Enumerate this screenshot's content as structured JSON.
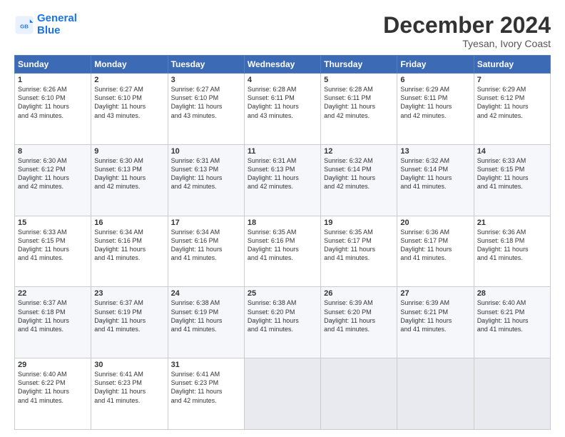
{
  "header": {
    "logo_line1": "General",
    "logo_line2": "Blue",
    "month": "December 2024",
    "location": "Tyesan, Ivory Coast"
  },
  "days_of_week": [
    "Sunday",
    "Monday",
    "Tuesday",
    "Wednesday",
    "Thursday",
    "Friday",
    "Saturday"
  ],
  "weeks": [
    [
      {
        "day": 1,
        "lines": [
          "Sunrise: 6:26 AM",
          "Sunset: 6:10 PM",
          "Daylight: 11 hours",
          "and 43 minutes."
        ]
      },
      {
        "day": 2,
        "lines": [
          "Sunrise: 6:27 AM",
          "Sunset: 6:10 PM",
          "Daylight: 11 hours",
          "and 43 minutes."
        ]
      },
      {
        "day": 3,
        "lines": [
          "Sunrise: 6:27 AM",
          "Sunset: 6:10 PM",
          "Daylight: 11 hours",
          "and 43 minutes."
        ]
      },
      {
        "day": 4,
        "lines": [
          "Sunrise: 6:28 AM",
          "Sunset: 6:11 PM",
          "Daylight: 11 hours",
          "and 43 minutes."
        ]
      },
      {
        "day": 5,
        "lines": [
          "Sunrise: 6:28 AM",
          "Sunset: 6:11 PM",
          "Daylight: 11 hours",
          "and 42 minutes."
        ]
      },
      {
        "day": 6,
        "lines": [
          "Sunrise: 6:29 AM",
          "Sunset: 6:11 PM",
          "Daylight: 11 hours",
          "and 42 minutes."
        ]
      },
      {
        "day": 7,
        "lines": [
          "Sunrise: 6:29 AM",
          "Sunset: 6:12 PM",
          "Daylight: 11 hours",
          "and 42 minutes."
        ]
      }
    ],
    [
      {
        "day": 8,
        "lines": [
          "Sunrise: 6:30 AM",
          "Sunset: 6:12 PM",
          "Daylight: 11 hours",
          "and 42 minutes."
        ]
      },
      {
        "day": 9,
        "lines": [
          "Sunrise: 6:30 AM",
          "Sunset: 6:13 PM",
          "Daylight: 11 hours",
          "and 42 minutes."
        ]
      },
      {
        "day": 10,
        "lines": [
          "Sunrise: 6:31 AM",
          "Sunset: 6:13 PM",
          "Daylight: 11 hours",
          "and 42 minutes."
        ]
      },
      {
        "day": 11,
        "lines": [
          "Sunrise: 6:31 AM",
          "Sunset: 6:13 PM",
          "Daylight: 11 hours",
          "and 42 minutes."
        ]
      },
      {
        "day": 12,
        "lines": [
          "Sunrise: 6:32 AM",
          "Sunset: 6:14 PM",
          "Daylight: 11 hours",
          "and 42 minutes."
        ]
      },
      {
        "day": 13,
        "lines": [
          "Sunrise: 6:32 AM",
          "Sunset: 6:14 PM",
          "Daylight: 11 hours",
          "and 41 minutes."
        ]
      },
      {
        "day": 14,
        "lines": [
          "Sunrise: 6:33 AM",
          "Sunset: 6:15 PM",
          "Daylight: 11 hours",
          "and 41 minutes."
        ]
      }
    ],
    [
      {
        "day": 15,
        "lines": [
          "Sunrise: 6:33 AM",
          "Sunset: 6:15 PM",
          "Daylight: 11 hours",
          "and 41 minutes."
        ]
      },
      {
        "day": 16,
        "lines": [
          "Sunrise: 6:34 AM",
          "Sunset: 6:16 PM",
          "Daylight: 11 hours",
          "and 41 minutes."
        ]
      },
      {
        "day": 17,
        "lines": [
          "Sunrise: 6:34 AM",
          "Sunset: 6:16 PM",
          "Daylight: 11 hours",
          "and 41 minutes."
        ]
      },
      {
        "day": 18,
        "lines": [
          "Sunrise: 6:35 AM",
          "Sunset: 6:16 PM",
          "Daylight: 11 hours",
          "and 41 minutes."
        ]
      },
      {
        "day": 19,
        "lines": [
          "Sunrise: 6:35 AM",
          "Sunset: 6:17 PM",
          "Daylight: 11 hours",
          "and 41 minutes."
        ]
      },
      {
        "day": 20,
        "lines": [
          "Sunrise: 6:36 AM",
          "Sunset: 6:17 PM",
          "Daylight: 11 hours",
          "and 41 minutes."
        ]
      },
      {
        "day": 21,
        "lines": [
          "Sunrise: 6:36 AM",
          "Sunset: 6:18 PM",
          "Daylight: 11 hours",
          "and 41 minutes."
        ]
      }
    ],
    [
      {
        "day": 22,
        "lines": [
          "Sunrise: 6:37 AM",
          "Sunset: 6:18 PM",
          "Daylight: 11 hours",
          "and 41 minutes."
        ]
      },
      {
        "day": 23,
        "lines": [
          "Sunrise: 6:37 AM",
          "Sunset: 6:19 PM",
          "Daylight: 11 hours",
          "and 41 minutes."
        ]
      },
      {
        "day": 24,
        "lines": [
          "Sunrise: 6:38 AM",
          "Sunset: 6:19 PM",
          "Daylight: 11 hours",
          "and 41 minutes."
        ]
      },
      {
        "day": 25,
        "lines": [
          "Sunrise: 6:38 AM",
          "Sunset: 6:20 PM",
          "Daylight: 11 hours",
          "and 41 minutes."
        ]
      },
      {
        "day": 26,
        "lines": [
          "Sunrise: 6:39 AM",
          "Sunset: 6:20 PM",
          "Daylight: 11 hours",
          "and 41 minutes."
        ]
      },
      {
        "day": 27,
        "lines": [
          "Sunrise: 6:39 AM",
          "Sunset: 6:21 PM",
          "Daylight: 11 hours",
          "and 41 minutes."
        ]
      },
      {
        "day": 28,
        "lines": [
          "Sunrise: 6:40 AM",
          "Sunset: 6:21 PM",
          "Daylight: 11 hours",
          "and 41 minutes."
        ]
      }
    ],
    [
      {
        "day": 29,
        "lines": [
          "Sunrise: 6:40 AM",
          "Sunset: 6:22 PM",
          "Daylight: 11 hours",
          "and 41 minutes."
        ]
      },
      {
        "day": 30,
        "lines": [
          "Sunrise: 6:41 AM",
          "Sunset: 6:23 PM",
          "Daylight: 11 hours",
          "and 41 minutes."
        ]
      },
      {
        "day": 31,
        "lines": [
          "Sunrise: 6:41 AM",
          "Sunset: 6:23 PM",
          "Daylight: 11 hours",
          "and 42 minutes."
        ]
      },
      null,
      null,
      null,
      null
    ]
  ]
}
